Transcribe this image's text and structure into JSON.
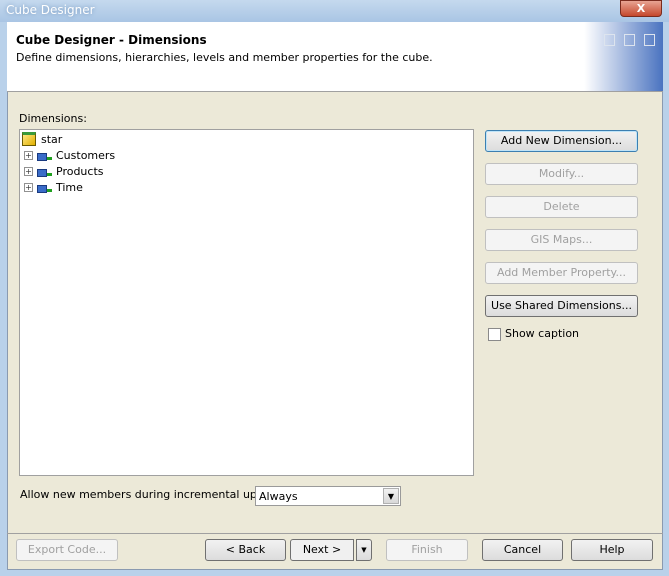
{
  "window": {
    "title": "Cube Designer",
    "close": "X"
  },
  "header": {
    "title": "Cube Designer - Dimensions",
    "subtitle": "Define dimensions, hierarchies, levels and member properties for the cube."
  },
  "dimensions": {
    "label": "Dimensions:",
    "root": "star",
    "items": [
      {
        "label": "Customers"
      },
      {
        "label": "Products"
      },
      {
        "label": "Time"
      }
    ]
  },
  "side_buttons": {
    "add": "Add New Dimension...",
    "modify": "Modify...",
    "delete": "Delete",
    "gis": "GIS Maps...",
    "member_property": "Add Member Property...",
    "shared": "Use Shared Dimensions..."
  },
  "show_caption": {
    "label": "Show caption",
    "checked": false
  },
  "incremental": {
    "label": "Allow new members during incremental update:",
    "value": "Always"
  },
  "footer": {
    "export": "Export Code...",
    "back": "< Back",
    "next": "Next >",
    "finish": "Finish",
    "cancel": "Cancel",
    "help": "Help"
  }
}
